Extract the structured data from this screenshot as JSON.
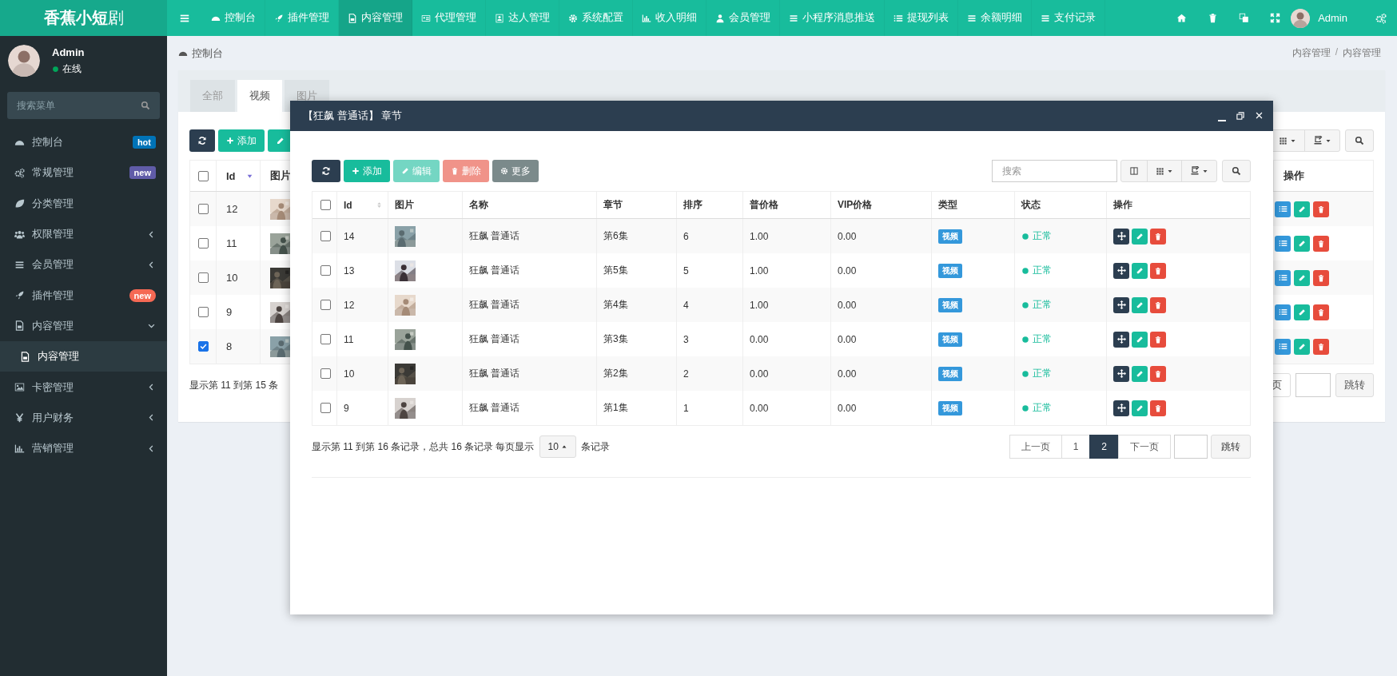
{
  "topbar": {
    "logo": "**香蕉小短**剧",
    "nav": [
      {
        "label": "控制台",
        "selected": false
      },
      {
        "label": "插件管理",
        "selected": false
      },
      {
        "label": "内容管理",
        "selected": true
      },
      {
        "label": "代理管理",
        "selected": false
      },
      {
        "label": "达人管理",
        "selected": false
      },
      {
        "label": "系统配置",
        "selected": false
      },
      {
        "label": "收入明细",
        "selected": false
      },
      {
        "label": "会员管理",
        "selected": false
      },
      {
        "label": "小程序消息推送",
        "selected": false
      },
      {
        "label": "提现列表",
        "selected": false
      },
      {
        "label": "余额明细",
        "selected": false
      },
      {
        "label": "支付记录",
        "selected": false
      }
    ],
    "user": "Admin"
  },
  "sidebar": {
    "user": {
      "name": "Admin",
      "status": "在线"
    },
    "search": {
      "placeholder": "搜索菜单"
    },
    "items": [
      {
        "label": "控制台",
        "selected": false,
        "badge": {
          "text": "hot",
          "color": "#0073b7"
        }
      },
      {
        "label": "常规管理",
        "selected": false,
        "badge": {
          "text": "new",
          "color": "#605ca8"
        }
      },
      {
        "label": "分类管理",
        "selected": false
      },
      {
        "label": "权限管理",
        "selected": false,
        "expanded": false
      },
      {
        "label": "会员管理",
        "selected": false,
        "expanded": false
      },
      {
        "label": "插件管理",
        "selected": false,
        "badge": {
          "text": "new",
          "color": "#f56954"
        }
      },
      {
        "label": "内容管理",
        "selected": false,
        "expanded": true,
        "children": [
          {
            "label": "内容管理",
            "selected": true
          }
        ]
      },
      {
        "label": "卡密管理",
        "selected": false,
        "expanded": false
      },
      {
        "label": "用户财务",
        "selected": false,
        "expanded": false
      },
      {
        "label": "营销管理",
        "selected": false,
        "expanded": false
      }
    ]
  },
  "breadcrumb": {
    "title": "控制台",
    "path": [
      "内容管理",
      "内容管理"
    ],
    "separator": "/"
  },
  "content": {
    "tabs": [
      {
        "label": "全部",
        "selected": false
      },
      {
        "label": "视频",
        "selected": true
      },
      {
        "label": "图片",
        "selected": false
      }
    ],
    "add_label": "添加",
    "table": {
      "header_checked": false,
      "columns": [
        "Id",
        "图片"
      ],
      "action_column": "操作",
      "rows": [
        {
          "id": "12",
          "checked": false
        },
        {
          "id": "11",
          "checked": false
        },
        {
          "id": "10",
          "checked": false
        },
        {
          "id": "9",
          "checked": false
        },
        {
          "id": "8",
          "checked": true
        }
      ]
    },
    "summary": "显示第 11 到第 15 条",
    "pagination": {
      "next": "页",
      "jump": "跳转"
    }
  },
  "modal": {
    "title": "【狂飙 普通话】 章节",
    "toolbar": [
      {
        "label": "添加",
        "kind": "add",
        "disabled": false
      },
      {
        "label": "编辑",
        "kind": "edit",
        "disabled": true
      },
      {
        "label": "删除",
        "kind": "delete",
        "disabled": true
      },
      {
        "label": "更多",
        "kind": "more",
        "disabled": false
      }
    ],
    "search": {
      "placeholder": "搜索"
    },
    "table": {
      "header_checked": false,
      "columns": [
        "Id",
        "图片",
        "名称",
        "章节",
        "排序",
        "普价格",
        "VIP价格",
        "类型",
        "状态",
        "操作"
      ],
      "rows": [
        {
          "id": "14",
          "name": "狂飙 普通话",
          "chapter": "第6集",
          "sort": "6",
          "price": "1.00",
          "vip_price": "0.00",
          "type": "视频",
          "status": "正常",
          "checked": false
        },
        {
          "id": "13",
          "name": "狂飙 普通话",
          "chapter": "第5集",
          "sort": "5",
          "price": "1.00",
          "vip_price": "0.00",
          "type": "视频",
          "status": "正常",
          "checked": false
        },
        {
          "id": "12",
          "name": "狂飙 普通话",
          "chapter": "第4集",
          "sort": "4",
          "price": "1.00",
          "vip_price": "0.00",
          "type": "视频",
          "status": "正常",
          "checked": false
        },
        {
          "id": "11",
          "name": "狂飙 普通话",
          "chapter": "第3集",
          "sort": "3",
          "price": "0.00",
          "vip_price": "0.00",
          "type": "视频",
          "status": "正常",
          "checked": false
        },
        {
          "id": "10",
          "name": "狂飙 普通话",
          "chapter": "第2集",
          "sort": "2",
          "price": "0.00",
          "vip_price": "0.00",
          "type": "视频",
          "status": "正常",
          "checked": false
        },
        {
          "id": "9",
          "name": "狂飙 普通话",
          "chapter": "第1集",
          "sort": "1",
          "price": "0.00",
          "vip_price": "0.00",
          "type": "视频",
          "status": "正常",
          "checked": false
        }
      ]
    },
    "summary": "显示第 11 到第 16 条记录，总共 16 条记录 每页显示",
    "page_size": "10",
    "summary_suffix": "条记录",
    "pagination": {
      "prev": "上一页",
      "pages": [
        {
          "label": "1",
          "selected": false
        },
        {
          "label": "2",
          "selected": true
        }
      ],
      "next": "下一页",
      "jump": "跳转"
    }
  }
}
